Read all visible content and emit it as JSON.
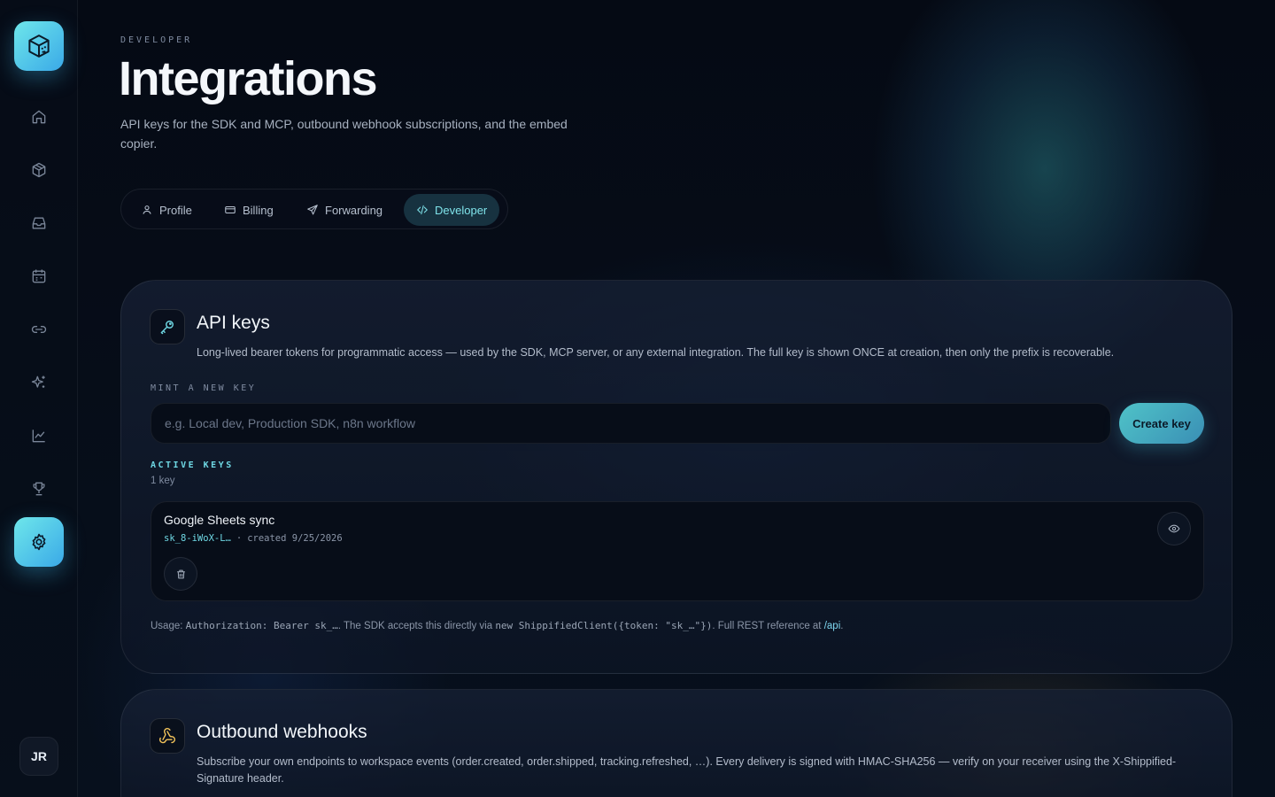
{
  "sidebar": {
    "logo_icon": "cube-logo-icon",
    "items": [
      {
        "icon": "home-icon"
      },
      {
        "icon": "package-icon"
      },
      {
        "icon": "inbox-icon"
      },
      {
        "icon": "calendar-icon"
      },
      {
        "icon": "link-icon"
      },
      {
        "icon": "sparkles-icon"
      },
      {
        "icon": "chart-line-icon"
      },
      {
        "icon": "trophy-icon"
      },
      {
        "icon": "settings-icon",
        "active": true
      }
    ],
    "avatar_initials": "JR"
  },
  "header": {
    "eyebrow": "DEVELOPER",
    "title": "Integrations",
    "subtitle": "API keys for the SDK and MCP, outbound webhook subscriptions, and the embed copier."
  },
  "tabs": [
    {
      "label": "Profile",
      "icon": "user-icon"
    },
    {
      "label": "Billing",
      "icon": "credit-card-icon"
    },
    {
      "label": "Forwarding",
      "icon": "send-icon"
    },
    {
      "label": "Developer",
      "icon": "code-icon",
      "active": true
    }
  ],
  "api_keys": {
    "title": "API keys",
    "description": "Long-lived bearer tokens for programmatic access — used by the SDK, MCP server, or any external integration. The full key is shown ONCE at creation, then only the prefix is recoverable.",
    "mint_label": "MINT A NEW KEY",
    "input_placeholder": "e.g. Local dev, Production SDK, n8n workflow",
    "create_button": "Create key",
    "active_label": "ACTIVE KEYS",
    "count": "1 key",
    "keys": [
      {
        "name": "Google Sheets sync",
        "prefix": "sk_8-iWoX-L…",
        "separator": "·",
        "created": "created 9/25/2026"
      }
    ],
    "usage": {
      "prefix": "Usage: ",
      "auth_code": "Authorization: Bearer sk_…",
      "mid": ". The SDK accepts this directly via ",
      "client_code": "new ShippifiedClient({token: \"sk_…\"})",
      "suffix": ". Full REST reference at ",
      "link": "/api",
      "end": "."
    }
  },
  "webhooks": {
    "title": "Outbound webhooks",
    "description": "Subscribe your own endpoints to workspace events (order.created, order.shipped, tracking.refreshed, …). Every delivery is signed with HMAC-SHA256 — verify on your receiver using the X-Shippified-Signature header."
  },
  "colors": {
    "accent": "#6fd8e4",
    "background": "#060b16",
    "webhook_icon": "#f0c25a"
  }
}
